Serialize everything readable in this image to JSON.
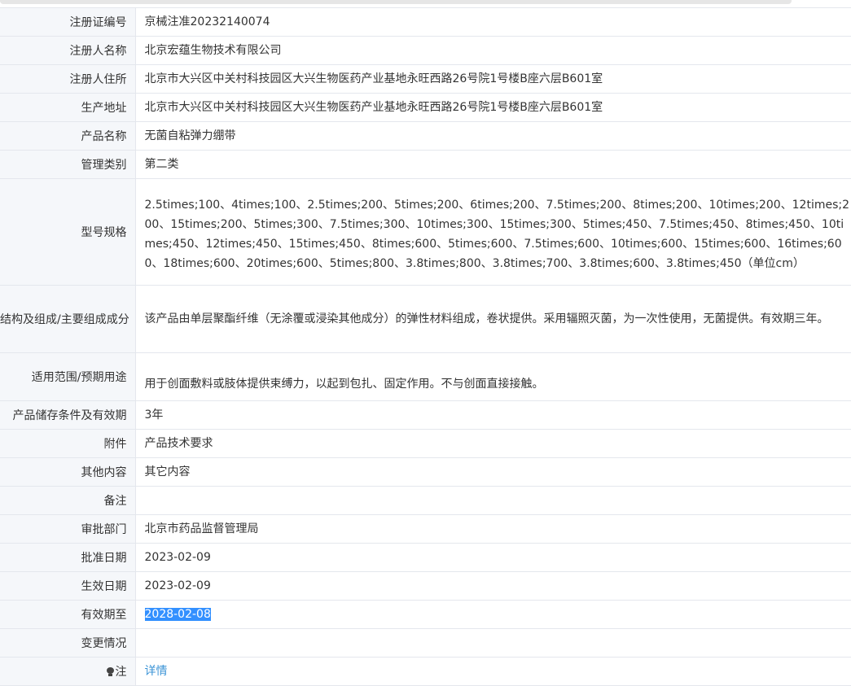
{
  "rows": [
    {
      "label": "注册证编号",
      "value": "京械注准20232140074"
    },
    {
      "label": "注册人名称",
      "value": "北京宏蕴生物技术有限公司"
    },
    {
      "label": "注册人住所",
      "value": "北京市大兴区中关村科技园区大兴生物医药产业基地永旺西路26号院1号楼B座六层B601室"
    },
    {
      "label": "生产地址",
      "value": "北京市大兴区中关村科技园区大兴生物医药产业基地永旺西路26号院1号楼B座六层B601室"
    },
    {
      "label": "产品名称",
      "value": "无菌自粘弹力绷带"
    },
    {
      "label": "管理类别",
      "value": "第二类"
    },
    {
      "label": "型号规格",
      "value": "2.5times;100、4times;100、2.5times;200、5times;200、6times;200、7.5times;200、8times;200、10times;200、12times;200、15times;200、5times;300、7.5times;300、10times;300、15times;300、5times;450、7.5times;450、8times;450、10times;450、12times;450、15times;450、8times;600、5times;600、7.5times;600、10times;600、15times;600、16times;600、18times;600、20times;600、5times;800、3.8times;800、3.8times;700、3.8times;600、3.8times;450（单位cm）"
    },
    {
      "label": "结构及组成/主要组成成分",
      "value": "该产品由单层聚酯纤维（无涂覆或浸染其他成分）的弹性材料组成，卷状提供。采用辐照灭菌，为一次性使用，无菌提供。有效期三年。"
    },
    {
      "label": "适用范围/预期用途",
      "value": "用于创面敷料或肢体提供束缚力，以起到包扎、固定作用。不与创面直接接触。"
    },
    {
      "label": "产品储存条件及有效期",
      "value": "3年"
    },
    {
      "label": "附件",
      "value": "产品技术要求"
    },
    {
      "label": "其他内容",
      "value": "其它内容"
    },
    {
      "label": "备注",
      "value": ""
    },
    {
      "label": "审批部门",
      "value": "北京市药品监督管理局"
    },
    {
      "label": "批准日期",
      "value": "2023-02-09"
    },
    {
      "label": "生效日期",
      "value": "2023-02-09"
    },
    {
      "label": "有效期至",
      "value": "2028-02-08"
    },
    {
      "label": "变更情况",
      "value": ""
    },
    {
      "label": "注",
      "value": "详情"
    }
  ],
  "icons": {
    "note": "lightbulb-icon"
  },
  "colors": {
    "label_bg": "#f5f7fa",
    "border": "#e4e7ed",
    "link": "#3a93d6",
    "selection": "#3390ff"
  }
}
